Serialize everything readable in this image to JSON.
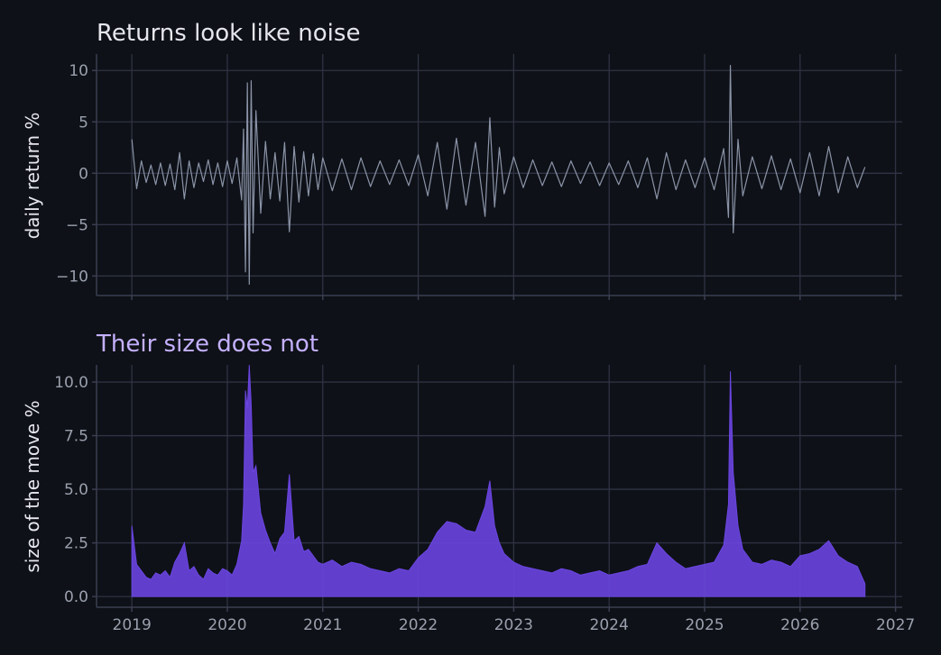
{
  "chart_data": [
    {
      "type": "line",
      "title": "Returns look like noise",
      "xlabel": "",
      "ylabel": "daily return %",
      "xlim": [
        2018.63,
        2027.07
      ],
      "ylim": [
        -11.9,
        11.6
      ],
      "yticks": [
        10,
        5,
        0,
        -5,
        -10
      ],
      "ytick_labels": [
        "10",
        "5",
        "0",
        "−5",
        "−10"
      ],
      "xticks": [
        2019,
        2020,
        2021,
        2022,
        2023,
        2024,
        2025,
        2026,
        2027
      ],
      "grid": true,
      "series": [
        {
          "values_note": "",
          "x": [
            2019.0,
            2019.05,
            2019.1,
            2019.15,
            2019.2,
            2019.25,
            2019.3,
            2019.35,
            2019.4,
            2019.45,
            2019.5,
            2019.55,
            2019.6,
            2019.65,
            2019.7,
            2019.75,
            2019.8,
            2019.85,
            2019.9,
            2019.95,
            2020.0,
            2020.05,
            2020.1,
            2020.15,
            2020.17,
            2020.19,
            2020.21,
            2020.23,
            2020.25,
            2020.27,
            2020.3,
            2020.35,
            2020.4,
            2020.45,
            2020.5,
            2020.55,
            2020.6,
            2020.65,
            2020.7,
            2020.75,
            2020.8,
            2020.85,
            2020.9,
            2020.95,
            2021.0,
            2021.1,
            2021.2,
            2021.3,
            2021.4,
            2021.5,
            2021.6,
            2021.7,
            2021.8,
            2021.9,
            2022.0,
            2022.1,
            2022.2,
            2022.3,
            2022.4,
            2022.5,
            2022.6,
            2022.7,
            2022.75,
            2022.8,
            2022.85,
            2022.9,
            2023.0,
            2023.1,
            2023.2,
            2023.3,
            2023.4,
            2023.5,
            2023.6,
            2023.7,
            2023.8,
            2023.9,
            2024.0,
            2024.1,
            2024.2,
            2024.3,
            2024.4,
            2024.5,
            2024.6,
            2024.7,
            2024.8,
            2024.9,
            2025.0,
            2025.1,
            2025.2,
            2025.25,
            2025.27,
            2025.3,
            2025.35,
            2025.4,
            2025.5,
            2025.6,
            2025.7,
            2025.8,
            2025.9,
            2026.0,
            2026.1,
            2026.2,
            2026.3,
            2026.4,
            2026.5,
            2026.6,
            2026.68
          ],
          "values": [
            3.3,
            -1.5,
            1.2,
            -0.9,
            0.8,
            -1.1,
            1.0,
            -1.2,
            0.9,
            -1.6,
            2.0,
            -2.5,
            1.2,
            -1.4,
            1.0,
            -0.8,
            1.3,
            -1.1,
            1.0,
            -1.3,
            1.2,
            -1.0,
            1.5,
            -2.6,
            4.3,
            -9.6,
            8.8,
            -10.8,
            9.0,
            -5.8,
            6.1,
            -3.9,
            3.1,
            -2.5,
            2.0,
            -2.7,
            3.0,
            -5.7,
            2.6,
            -2.8,
            2.1,
            -2.2,
            1.9,
            -1.6,
            1.5,
            -1.7,
            1.4,
            -1.6,
            1.5,
            -1.3,
            1.2,
            -1.1,
            1.3,
            -1.2,
            1.8,
            -2.2,
            3.0,
            -3.5,
            3.4,
            -3.1,
            3.0,
            -4.2,
            5.4,
            -3.3,
            2.5,
            -2.0,
            1.6,
            -1.4,
            1.3,
            -1.2,
            1.1,
            -1.3,
            1.2,
            -1.0,
            1.1,
            -1.2,
            1.0,
            -1.1,
            1.2,
            -1.4,
            1.5,
            -2.5,
            2.0,
            -1.6,
            1.3,
            -1.4,
            1.5,
            -1.6,
            2.4,
            -4.3,
            10.5,
            -5.8,
            3.3,
            -2.2,
            1.6,
            -1.5,
            1.7,
            -1.6,
            1.4,
            -1.9,
            2.0,
            -2.2,
            2.6,
            -1.9,
            1.6,
            -1.4,
            0.6
          ]
        }
      ],
      "colors": {
        "line": "#8b94a8",
        "title": "#e6e6ee"
      }
    },
    {
      "type": "area",
      "title": "Their size does not",
      "xlabel": "",
      "ylabel": "size of the move %",
      "xlim": [
        2018.63,
        2027.07
      ],
      "ylim": [
        -0.5,
        10.8
      ],
      "yticks": [
        10.0,
        7.5,
        5.0,
        2.5,
        0.0
      ],
      "ytick_labels": [
        "10.0",
        "7.5",
        "5.0",
        "2.5",
        "0.0"
      ],
      "xticks": [
        2019,
        2020,
        2021,
        2022,
        2023,
        2024,
        2025,
        2026,
        2027
      ],
      "xtick_labels": [
        "2019",
        "2020",
        "2021",
        "2022",
        "2023",
        "2024",
        "2025",
        "2026",
        "2027"
      ],
      "grid": true,
      "series": [
        {
          "values_note": "",
          "x": [
            2019.0,
            2019.05,
            2019.1,
            2019.15,
            2019.2,
            2019.25,
            2019.3,
            2019.35,
            2019.4,
            2019.45,
            2019.5,
            2019.55,
            2019.6,
            2019.65,
            2019.7,
            2019.75,
            2019.8,
            2019.85,
            2019.9,
            2019.95,
            2020.0,
            2020.05,
            2020.1,
            2020.15,
            2020.17,
            2020.19,
            2020.21,
            2020.23,
            2020.25,
            2020.27,
            2020.3,
            2020.35,
            2020.4,
            2020.45,
            2020.5,
            2020.55,
            2020.6,
            2020.65,
            2020.7,
            2020.75,
            2020.8,
            2020.85,
            2020.9,
            2020.95,
            2021.0,
            2021.1,
            2021.2,
            2021.3,
            2021.4,
            2021.5,
            2021.6,
            2021.7,
            2021.8,
            2021.9,
            2022.0,
            2022.1,
            2022.2,
            2022.3,
            2022.4,
            2022.5,
            2022.6,
            2022.7,
            2022.75,
            2022.8,
            2022.85,
            2022.9,
            2023.0,
            2023.1,
            2023.2,
            2023.3,
            2023.4,
            2023.5,
            2023.6,
            2023.7,
            2023.8,
            2023.9,
            2024.0,
            2024.1,
            2024.2,
            2024.3,
            2024.4,
            2024.5,
            2024.6,
            2024.7,
            2024.8,
            2024.9,
            2025.0,
            2025.1,
            2025.2,
            2025.25,
            2025.27,
            2025.3,
            2025.35,
            2025.4,
            2025.5,
            2025.6,
            2025.7,
            2025.8,
            2025.9,
            2026.0,
            2026.1,
            2026.2,
            2026.3,
            2026.4,
            2026.5,
            2026.6,
            2026.68
          ],
          "values": [
            3.3,
            1.5,
            1.2,
            0.9,
            0.8,
            1.1,
            1.0,
            1.2,
            0.9,
            1.6,
            2.0,
            2.5,
            1.2,
            1.4,
            1.0,
            0.8,
            1.3,
            1.1,
            1.0,
            1.3,
            1.2,
            1.0,
            1.5,
            2.6,
            4.3,
            9.6,
            8.8,
            10.8,
            9.0,
            5.8,
            6.1,
            3.9,
            3.1,
            2.5,
            2.0,
            2.7,
            3.0,
            5.7,
            2.6,
            2.8,
            2.1,
            2.2,
            1.9,
            1.6,
            1.5,
            1.7,
            1.4,
            1.6,
            1.5,
            1.3,
            1.2,
            1.1,
            1.3,
            1.2,
            1.8,
            2.2,
            3.0,
            3.5,
            3.4,
            3.1,
            3.0,
            4.2,
            5.4,
            3.3,
            2.5,
            2.0,
            1.6,
            1.4,
            1.3,
            1.2,
            1.1,
            1.3,
            1.2,
            1.0,
            1.1,
            1.2,
            1.0,
            1.1,
            1.2,
            1.4,
            1.5,
            2.5,
            2.0,
            1.6,
            1.3,
            1.4,
            1.5,
            1.6,
            2.4,
            4.3,
            10.5,
            5.8,
            3.3,
            2.2,
            1.6,
            1.5,
            1.7,
            1.6,
            1.4,
            1.9,
            2.0,
            2.2,
            2.6,
            1.9,
            1.6,
            1.4,
            0.6
          ]
        }
      ],
      "colors": {
        "fill": "#6a45e0",
        "title": "#c4b0ff"
      }
    }
  ]
}
